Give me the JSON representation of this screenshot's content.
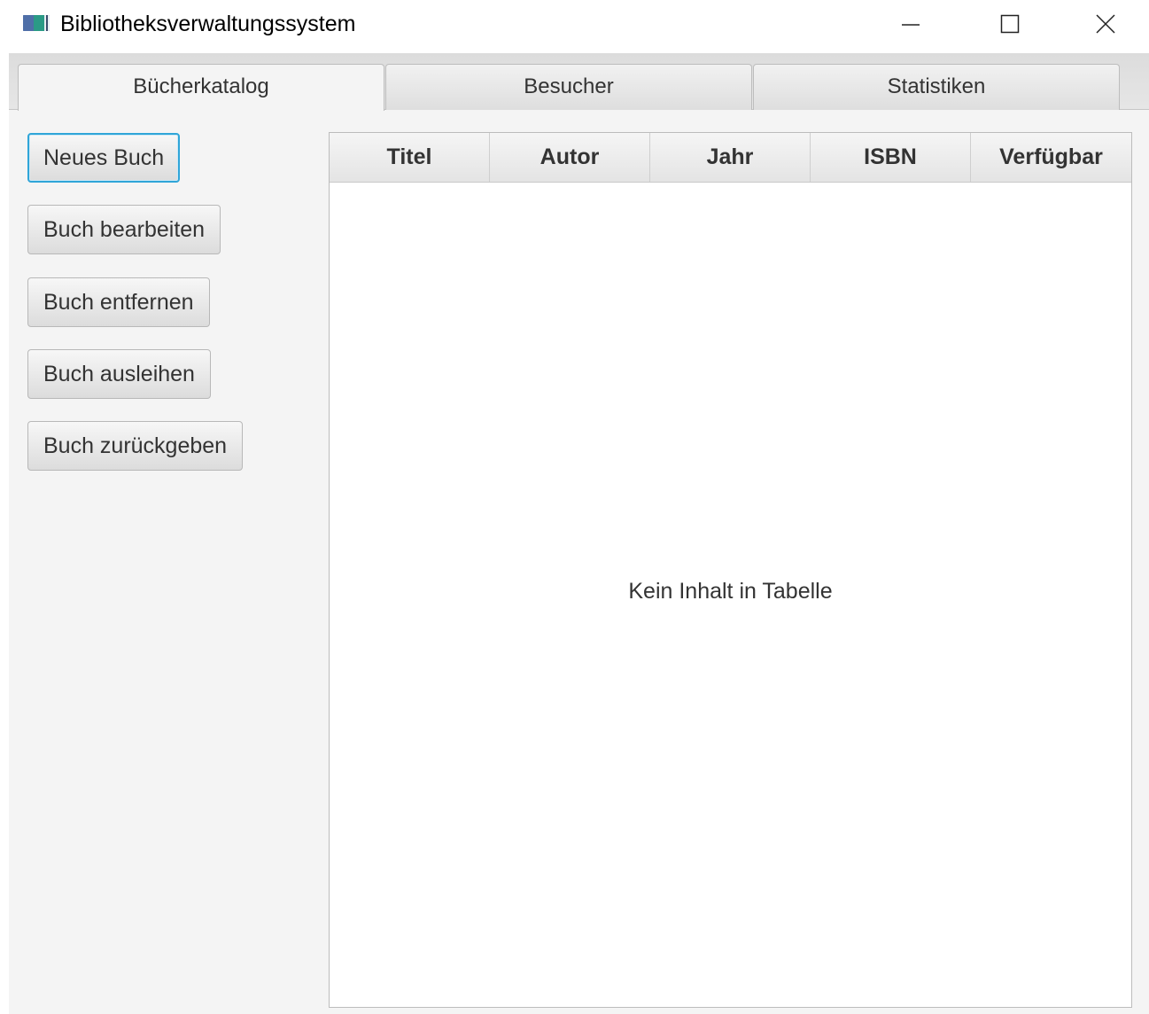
{
  "window": {
    "title": "Bibliotheksverwaltungssystem",
    "controls": [
      "minimize",
      "maximize",
      "close"
    ]
  },
  "tabs": [
    {
      "label": "Bücherkatalog",
      "active": true
    },
    {
      "label": "Besucher",
      "active": false
    },
    {
      "label": "Statistiken",
      "active": false
    }
  ],
  "sidebar": {
    "buttons": [
      {
        "label": "Neues Buch",
        "focused": true
      },
      {
        "label": "Buch bearbeiten"
      },
      {
        "label": "Buch entfernen"
      },
      {
        "label": "Buch ausleihen"
      },
      {
        "label": "Buch zurückgeben"
      }
    ]
  },
  "table": {
    "columns": [
      "Titel",
      "Autor",
      "Jahr",
      "ISBN",
      "Verfügbar"
    ],
    "rows": [],
    "placeholder": "Kein Inhalt in Tabelle"
  },
  "colors": {
    "focus_accent": "#2fa5d8",
    "background": "#f4f4f4"
  }
}
